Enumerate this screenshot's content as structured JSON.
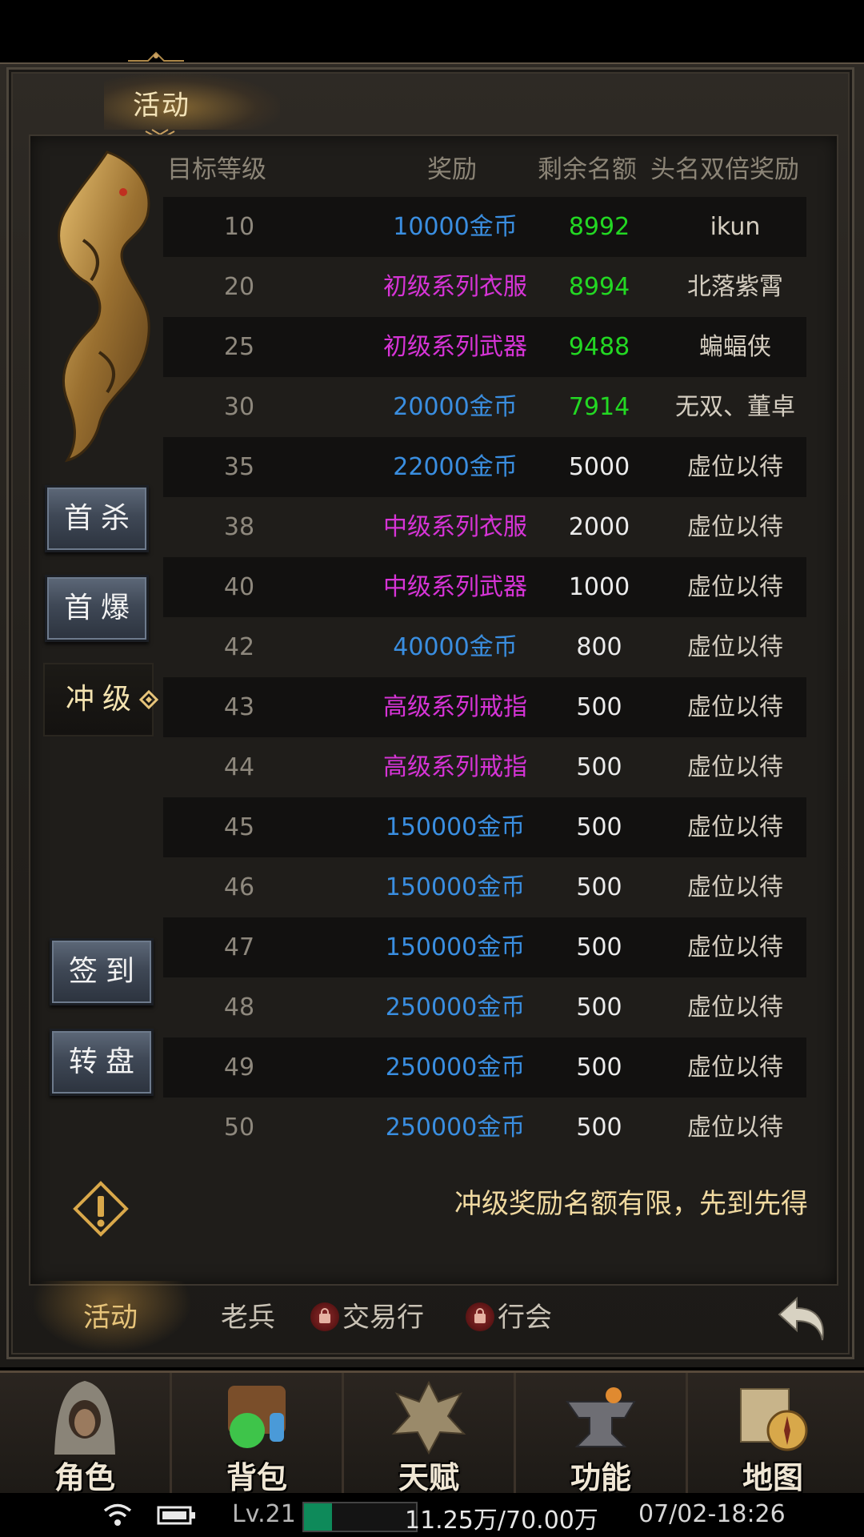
{
  "window": {
    "title": "活动"
  },
  "side_buttons": [
    {
      "label": "首杀",
      "active": false
    },
    {
      "label": "首爆",
      "active": false
    },
    {
      "label": "冲级",
      "active": true
    },
    {
      "label": "签到",
      "active": false
    },
    {
      "label": "转盘",
      "active": false
    }
  ],
  "table": {
    "headers": [
      "目标等级",
      "奖励",
      "剩余名额",
      "头名双倍奖励"
    ],
    "rows": [
      {
        "level": "10",
        "reward": "10000金币",
        "reward_color": "blue",
        "remaining": "8992",
        "remaining_color": "green",
        "first": "ikun"
      },
      {
        "level": "20",
        "reward": "初级系列衣服",
        "reward_color": "purple",
        "remaining": "8994",
        "remaining_color": "green",
        "first": "北落紫霄"
      },
      {
        "level": "25",
        "reward": "初级系列武器",
        "reward_color": "purple",
        "remaining": "9488",
        "remaining_color": "green",
        "first": "蝙蝠侠"
      },
      {
        "level": "30",
        "reward": "20000金币",
        "reward_color": "blue",
        "remaining": "7914",
        "remaining_color": "green",
        "first": "无双、董卓"
      },
      {
        "level": "35",
        "reward": "22000金币",
        "reward_color": "blue",
        "remaining": "5000",
        "remaining_color": "white",
        "first": "虚位以待"
      },
      {
        "level": "38",
        "reward": "中级系列衣服",
        "reward_color": "purple",
        "remaining": "2000",
        "remaining_color": "white",
        "first": "虚位以待"
      },
      {
        "level": "40",
        "reward": "中级系列武器",
        "reward_color": "purple",
        "remaining": "1000",
        "remaining_color": "white",
        "first": "虚位以待"
      },
      {
        "level": "42",
        "reward": "40000金币",
        "reward_color": "blue",
        "remaining": "800",
        "remaining_color": "white",
        "first": "虚位以待"
      },
      {
        "level": "43",
        "reward": "高级系列戒指",
        "reward_color": "purple",
        "remaining": "500",
        "remaining_color": "white",
        "first": "虚位以待"
      },
      {
        "level": "44",
        "reward": "高级系列戒指",
        "reward_color": "purple",
        "remaining": "500",
        "remaining_color": "white",
        "first": "虚位以待"
      },
      {
        "level": "45",
        "reward": "150000金币",
        "reward_color": "blue",
        "remaining": "500",
        "remaining_color": "white",
        "first": "虚位以待"
      },
      {
        "level": "46",
        "reward": "150000金币",
        "reward_color": "blue",
        "remaining": "500",
        "remaining_color": "white",
        "first": "虚位以待"
      },
      {
        "level": "47",
        "reward": "150000金币",
        "reward_color": "blue",
        "remaining": "500",
        "remaining_color": "white",
        "first": "虚位以待"
      },
      {
        "level": "48",
        "reward": "250000金币",
        "reward_color": "blue",
        "remaining": "500",
        "remaining_color": "white",
        "first": "虚位以待"
      },
      {
        "level": "49",
        "reward": "250000金币",
        "reward_color": "blue",
        "remaining": "500",
        "remaining_color": "white",
        "first": "虚位以待"
      },
      {
        "level": "50",
        "reward": "250000金币",
        "reward_color": "blue",
        "remaining": "500",
        "remaining_color": "white",
        "first": "虚位以待"
      }
    ]
  },
  "notice": "冲级奖励名额有限，先到先得",
  "tabs": [
    {
      "label": "活动",
      "active": true,
      "locked": false
    },
    {
      "label": "老兵",
      "active": false,
      "locked": false
    },
    {
      "label": "交易行",
      "active": false,
      "locked": true
    },
    {
      "label": "行会",
      "active": false,
      "locked": true
    }
  ],
  "bottom_nav": [
    {
      "label": "角色",
      "icon": "hooded-character-icon"
    },
    {
      "label": "背包",
      "icon": "bag-potions-icon"
    },
    {
      "label": "天赋",
      "icon": "dragon-emblem-icon"
    },
    {
      "label": "功能",
      "icon": "anvil-icon"
    },
    {
      "label": "地图",
      "icon": "map-compass-icon"
    }
  ],
  "status_bar": {
    "level": "Lv.21",
    "xp_fraction": 0.25,
    "exp": "11.25万/70.00万",
    "time": "07/02-18:26"
  },
  "colors": {
    "blue": "#3a8ee0",
    "purple": "#d634d6",
    "green": "#23d823",
    "white": "#ececec",
    "gold": "#e7c47a"
  }
}
